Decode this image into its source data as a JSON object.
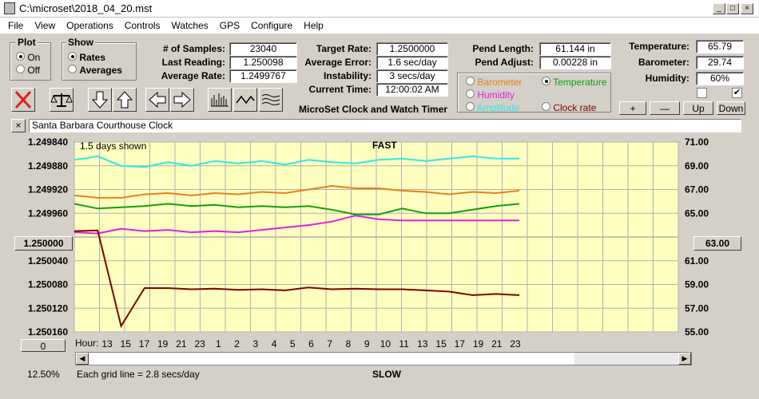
{
  "window": {
    "title": "C:\\microset\\2018_04_20.mst"
  },
  "menu": [
    "File",
    "View",
    "Operations",
    "Controls",
    "Watches",
    "GPS",
    "Configure",
    "Help"
  ],
  "plot": {
    "legend": "Plot",
    "on": "On",
    "off": "Off",
    "selected": "On"
  },
  "show": {
    "legend": "Show",
    "rates": "Rates",
    "averages": "Averages",
    "selected": "Rates"
  },
  "stats": {
    "samples_label": "# of Samples:",
    "samples": "23040",
    "last_label": "Last Reading:",
    "last": "1.250098",
    "avg_label": "Average Rate:",
    "avg": "1.2499767",
    "target_label": "Target Rate:",
    "target": "1.2500000",
    "err_label": "Average Error:",
    "err": "1.6 sec/day",
    "inst_label": "Instability:",
    "inst": "3 secs/day",
    "time_label": "Current Time:",
    "time": "12:00:02 AM",
    "pendlen_label": "Pend Length:",
    "pendlen": "61.144 in",
    "pendadj_label": "Pend Adjust:",
    "pendadj": "0.00228 in",
    "temp_label": "Temperature:",
    "temp": "65.79",
    "baro_label": "Barometer:",
    "baro": "29.74",
    "hum_label": "Humidity:",
    "hum": "60%"
  },
  "app_title": "MicroSet Clock and Watch Timer",
  "sensors": {
    "barometer": "Barometer",
    "temperature": "Temperature",
    "humidity": "Humidity",
    "amplitude": "Amplitude",
    "clockrate": "Clock rate",
    "selected": "Temperature"
  },
  "sensor_buttons": {
    "plus": "+",
    "minus": "—",
    "up": "Up",
    "down": "Down"
  },
  "checkboxes": [
    false,
    true
  ],
  "clock_name": "Santa Barbara Courthouse Clock",
  "colors": {
    "barometer": "#e8801a",
    "temperature": "#10a010",
    "humidity": "#e020e0",
    "amplitude": "#30e8e8",
    "clockrate": "#800000",
    "plotbg": "#ffffc0"
  },
  "chart_data": {
    "type": "line",
    "top_label": "FAST",
    "bottom_label": "SLOW",
    "days_shown": "1.5 days shown",
    "grid_note": "Each grid line = 2.8 secs/day",
    "zoom": "12.50%",
    "hour_label": "Hour:",
    "x_ticks": [
      "13",
      "15",
      "17",
      "19",
      "21",
      "23",
      "1",
      "2",
      "3",
      "4",
      "5",
      "6",
      "7",
      "8",
      "9",
      "10",
      "11",
      "13",
      "15",
      "17",
      "19",
      "21",
      "23"
    ],
    "left_ticks": [
      "1.249840",
      "1.249880",
      "1.249920",
      "1.249960",
      "1.250000",
      "1.250040",
      "1.250080",
      "1.250120",
      "1.250160"
    ],
    "right_ticks": [
      "71.00",
      "69.00",
      "67.00",
      "65.00",
      "63.00",
      "61.00",
      "59.00",
      "57.00",
      "55.00"
    ],
    "left_button": "1.250000",
    "right_button": "63.00",
    "bottom_left_button": "0",
    "series": [
      {
        "name": "Amplitude",
        "color": "#30e8e8",
        "values": [
          69.5,
          69.8,
          69.0,
          68.9,
          69.3,
          69.0,
          69.4,
          69.2,
          69.4,
          69.1,
          69.5,
          69.3,
          69.2,
          69.5,
          69.6,
          69.4,
          69.6,
          69.8,
          69.6,
          69.6
        ]
      },
      {
        "name": "Barometer",
        "color": "#e8801a",
        "values": [
          66.5,
          66.3,
          66.3,
          66.6,
          66.7,
          66.5,
          66.7,
          66.6,
          66.8,
          66.7,
          67.0,
          67.3,
          67.1,
          67.1,
          66.9,
          66.8,
          66.6,
          66.8,
          66.7,
          66.9
        ]
      },
      {
        "name": "Temperature",
        "color": "#10a010",
        "values": [
          65.8,
          65.4,
          65.5,
          65.6,
          65.8,
          65.6,
          65.7,
          65.5,
          65.6,
          65.5,
          65.6,
          65.3,
          64.9,
          64.9,
          65.4,
          65.0,
          65.0,
          65.3,
          65.6,
          65.8
        ]
      },
      {
        "name": "Humidity",
        "color": "#e020e0",
        "values": [
          63.4,
          63.3,
          63.7,
          63.5,
          63.6,
          63.4,
          63.5,
          63.4,
          63.6,
          63.8,
          64.0,
          64.3,
          64.8,
          64.5,
          64.4,
          64.4,
          64.4,
          64.4,
          64.4,
          64.4
        ]
      },
      {
        "name": "Clock rate",
        "color": "#800000",
        "values": [
          1.24999,
          1.249989,
          1.25015,
          1.250086,
          1.250086,
          1.250088,
          1.250087,
          1.250089,
          1.250088,
          1.25009,
          1.250085,
          1.250088,
          1.250087,
          1.250088,
          1.250088,
          1.25009,
          1.250092,
          1.250098,
          1.250096,
          1.250098
        ]
      }
    ]
  }
}
